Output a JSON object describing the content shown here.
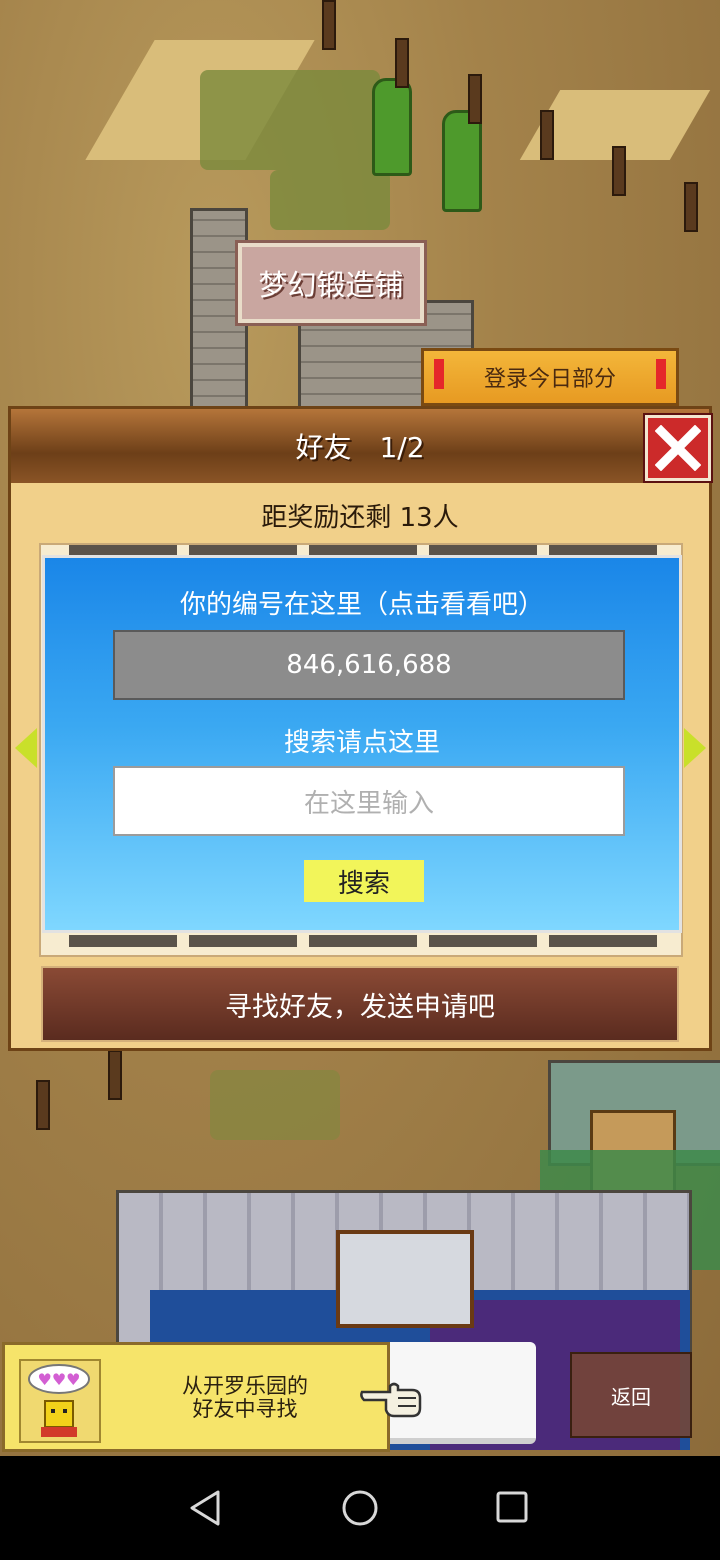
{
  "world": {
    "shop_sign": "梦幻锻造铺",
    "login_banner": "登录今日部分"
  },
  "dialog": {
    "title": "好友　1/2",
    "reward_text": "距奖励还剩 13人",
    "id_caption": "你的编号在这里（点击看看吧）",
    "player_id": "846,616,688",
    "search_caption": "搜索请点这里",
    "search_placeholder": "在这里输入",
    "search_button": "搜索",
    "find_friends_button": "寻找好友，发送申请吧"
  },
  "bottom": {
    "kairo_line1": "从开罗乐园的",
    "kairo_line2": "好友中寻找",
    "back_button": "返回"
  },
  "colors": {
    "panel_blue": "#1a86e8",
    "search_button": "#f2f55a",
    "close_red": "#cc2a2a",
    "arrow": "#c9e02a"
  },
  "icons": [
    "close-icon",
    "arrow-left-icon",
    "arrow-right-icon",
    "hand-pointer-icon",
    "kairo-avatar-icon",
    "nav-back-icon",
    "nav-home-icon",
    "nav-recents-icon"
  ]
}
